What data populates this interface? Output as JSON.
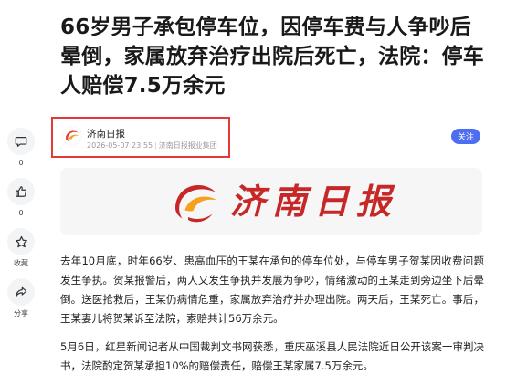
{
  "article": {
    "title": "66岁男子承包停车位，因停车费与人争吵后晕倒，家属放弃治疗出院后死亡，法院：停车人赔偿7.5万余元",
    "paragraphs": [
      "去年10月底，时年66岁、患高血压的王某在承包的停车位处，与停车男子贺某因收费问题发生争执。贺某报警后，两人又发生争执并发展为争吵，情绪激动的王某走到旁边坐下后晕倒。送医抢救后，王某仍病情危重，家属放弃治疗并办理出院。两天后，王某死亡。事后，王某妻儿将贺某诉至法院，索赔共计56万余元。",
      "5月6日，红星新闻记者从中国裁判文书网获悉，重庆巫溪县人民法院近日公开该案一审判决书，法院酌定贺某承担10%的赔偿责任，赔偿王某家属7.5万余元。"
    ]
  },
  "author": {
    "name": "济南日报",
    "date": "2026-05-07 23:55",
    "source": "济南日报报业集团",
    "follow_label": "关注"
  },
  "banner": {
    "text": "济南日报"
  },
  "sidebar": {
    "comment_count": "0",
    "like_count": "0",
    "collect_label": "收藏",
    "share_label": "分享"
  },
  "colors": {
    "accent": "#4e6ef2",
    "highlight_border": "#e53935",
    "brand_red": "#c62828"
  },
  "icons": [
    "comment-icon",
    "thumbs-up-icon",
    "star-icon",
    "share-icon"
  ]
}
